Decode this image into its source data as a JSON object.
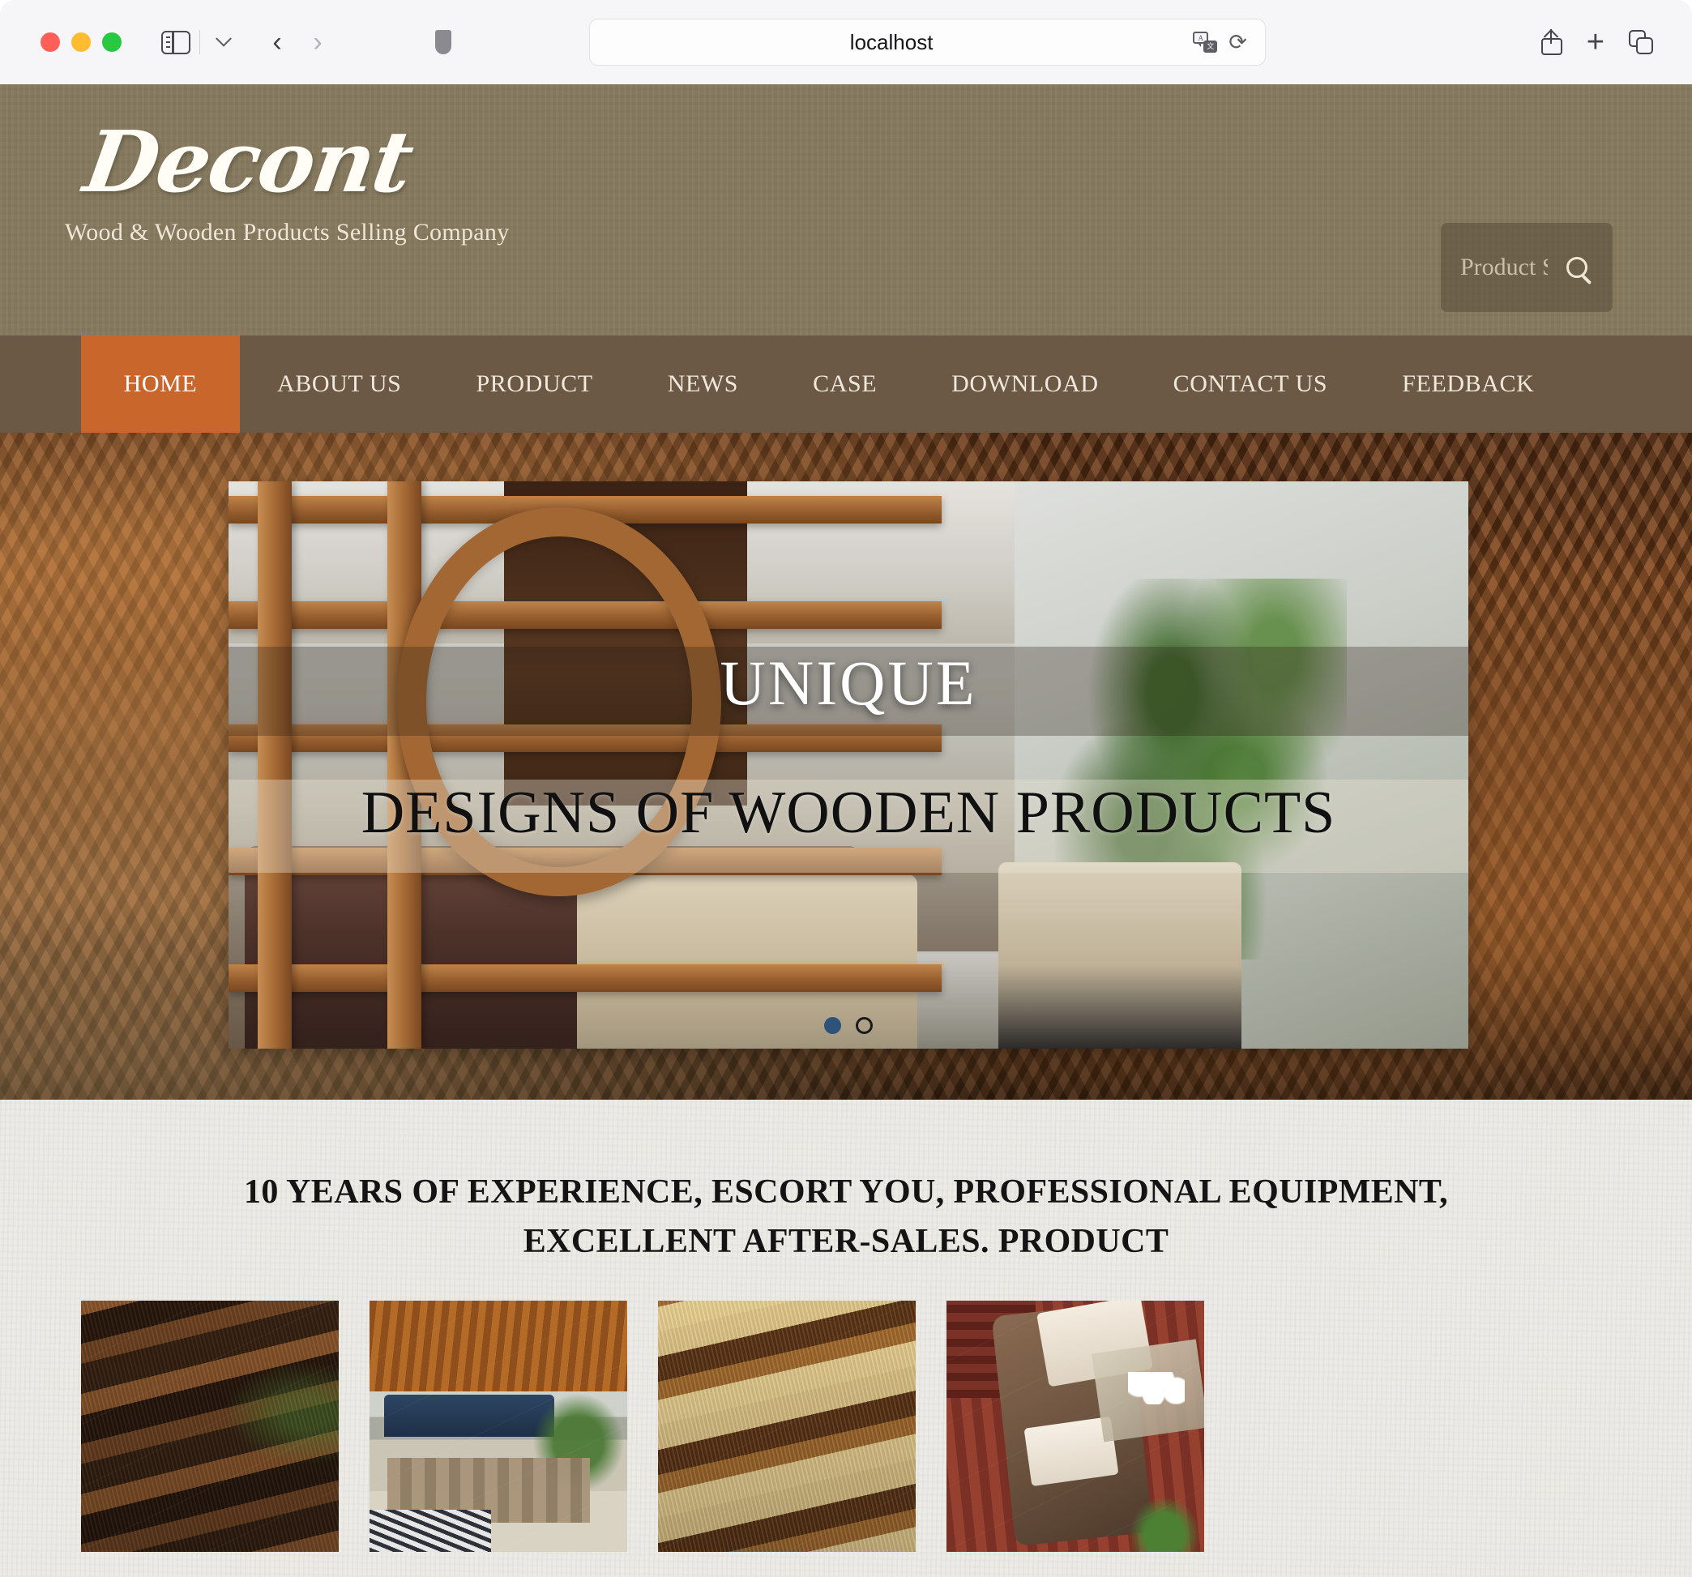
{
  "browser": {
    "url": "localhost",
    "icons": {
      "sidebar": "sidebar-toggle-icon",
      "chevron": "chevron-down-icon",
      "back": "back-arrow-icon",
      "forward": "forward-arrow-icon",
      "shield": "privacy-shield-icon",
      "translate": "translate-icon",
      "reload": "reload-icon",
      "share": "share-icon",
      "newtab": "new-tab-icon",
      "tabs": "tab-overview-icon"
    },
    "translate_glyph_a": "A",
    "translate_glyph_b": "文",
    "reload_glyph": "⟳",
    "plus_glyph": "+",
    "back_glyph": "‹",
    "forward_glyph": "›"
  },
  "site": {
    "brand_name": "Decont",
    "brand_tagline": "Wood & Wooden Products Selling Company",
    "search": {
      "placeholder": "Product Search",
      "value": "",
      "button_label": "search-icon"
    },
    "colors": {
      "header_bg": "#86795e",
      "nav_bg": "#6b5945",
      "nav_active": "#c9662b",
      "section_bg": "#eceae5",
      "dot_active": "#2f5378"
    }
  },
  "nav": {
    "items": [
      {
        "label": "HOME",
        "active": true
      },
      {
        "label": "ABOUT US",
        "active": false
      },
      {
        "label": "PRODUCT",
        "active": false
      },
      {
        "label": "NEWS",
        "active": false
      },
      {
        "label": "CASE",
        "active": false
      },
      {
        "label": "DOWNLOAD",
        "active": false
      },
      {
        "label": "CONTACT US",
        "active": false
      },
      {
        "label": "FEEDBACK",
        "active": false
      }
    ]
  },
  "hero": {
    "title": "UNIQUE",
    "subtitle": "DESIGNS OF WOODEN PRODUCTS",
    "slides_total": 2,
    "active_slide": 1,
    "dots": [
      {
        "index": 1,
        "active": true
      },
      {
        "index": 2,
        "active": false
      }
    ]
  },
  "products": {
    "section_title": "10 YEARS OF EXPERIENCE, ESCORT YOU, PROFESSIONAL EQUIPMENT, EXCELLENT AFTER-SALES. PRODUCT",
    "cards": [
      {
        "alt": "stacked-dark-timber-beams"
      },
      {
        "alt": "outdoor-patio-wooden-ceiling"
      },
      {
        "alt": "light-golden-wood-beams"
      },
      {
        "alt": "rattan-furniture-wood-decking"
      }
    ]
  }
}
